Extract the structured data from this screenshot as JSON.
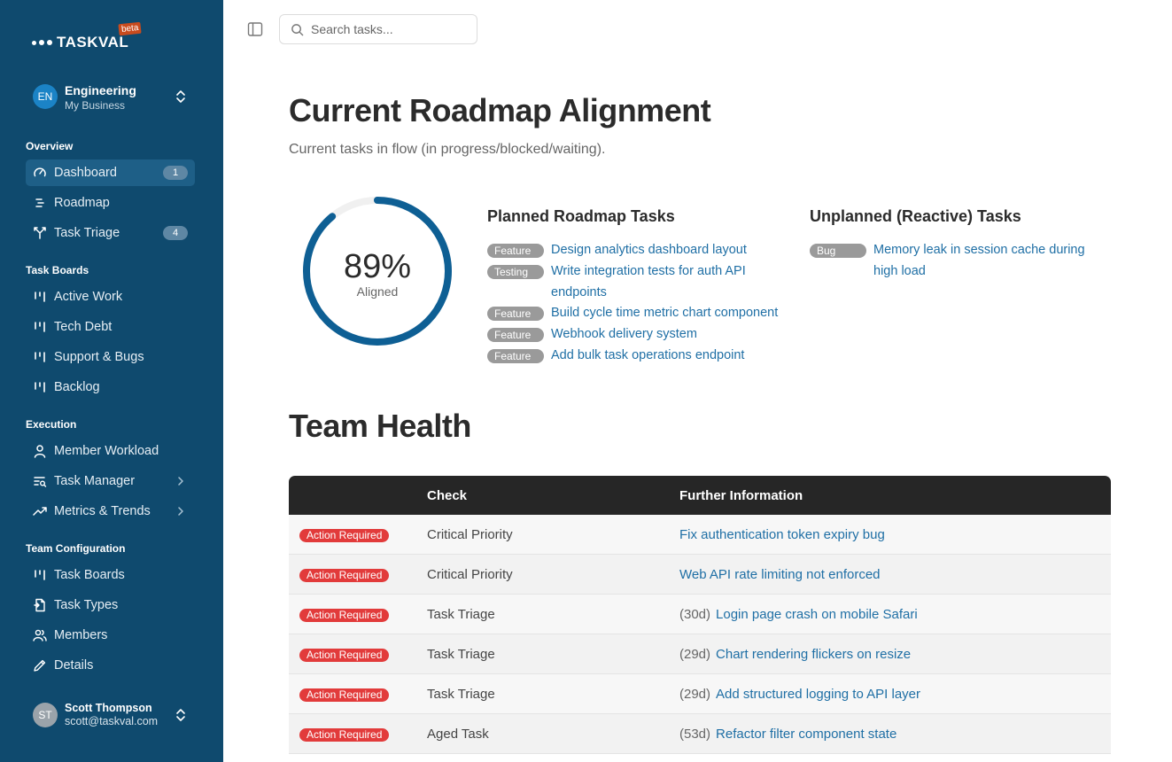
{
  "app": {
    "logo": "TASKVAL",
    "beta": "beta"
  },
  "org": {
    "initials": "EN",
    "name": "Engineering",
    "sub": "My Business"
  },
  "sidebar": {
    "sections": [
      {
        "title": "Overview"
      },
      {
        "title": "Task Boards"
      },
      {
        "title": "Execution"
      },
      {
        "title": "Team Configuration"
      }
    ],
    "items": [
      {
        "label": "Dashboard",
        "badge": "1",
        "icon": "gauge-icon"
      },
      {
        "label": "Roadmap",
        "icon": "list-icon"
      },
      {
        "label": "Task Triage",
        "badge": "4",
        "icon": "split-icon"
      },
      {
        "label": "Active Work",
        "icon": "board-icon"
      },
      {
        "label": "Tech Debt",
        "icon": "board-icon"
      },
      {
        "label": "Support & Bugs",
        "icon": "board-icon"
      },
      {
        "label": "Backlog",
        "icon": "board-icon"
      },
      {
        "label": "Member Workload",
        "icon": "user-icon"
      },
      {
        "label": "Task Manager",
        "icon": "list-search-icon"
      },
      {
        "label": "Metrics & Trends",
        "icon": "trend-icon"
      },
      {
        "label": "Task Boards",
        "icon": "board-icon"
      },
      {
        "label": "Task Types",
        "icon": "file-icon"
      },
      {
        "label": "Members",
        "icon": "users-icon"
      },
      {
        "label": "Details",
        "icon": "pencil-icon"
      }
    ]
  },
  "user": {
    "initials": "ST",
    "name": "Scott Thompson",
    "email": "scott@taskval.com"
  },
  "search": {
    "placeholder": "Search tasks..."
  },
  "main": {
    "title": "Current Roadmap Alignment",
    "subtitle": "Current tasks in flow (in progress/blocked/waiting).",
    "alignment": {
      "value": "89%",
      "percent": 89,
      "label": "Aligned",
      "color": "#0e5f94"
    },
    "planned": {
      "title": "Planned Roadmap Tasks",
      "tasks": [
        {
          "tag": "Feature",
          "text": "Design analytics dashboard layout"
        },
        {
          "tag": "Testing",
          "text": "Write integration tests for auth API endpoints"
        },
        {
          "tag": "Feature",
          "text": "Build cycle time metric chart component"
        },
        {
          "tag": "Feature",
          "text": "Webhook delivery system"
        },
        {
          "tag": "Feature",
          "text": "Add bulk task operations endpoint"
        }
      ]
    },
    "unplanned": {
      "title": "Unplanned (Reactive) Tasks",
      "tasks": [
        {
          "tag": "Bug",
          "text": "Memory leak in session cache during high load"
        }
      ]
    },
    "health": {
      "title": "Team Health",
      "columns": [
        "Check",
        "Further Information"
      ],
      "rows": [
        {
          "status": "Action Required",
          "check": "Critical Priority",
          "days": "",
          "info": "Fix authentication token expiry bug"
        },
        {
          "status": "Action Required",
          "check": "Critical Priority",
          "days": "",
          "info": "Web API rate limiting not enforced"
        },
        {
          "status": "Action Required",
          "check": "Task Triage",
          "days": "(30d)",
          "info": "Login page crash on mobile Safari"
        },
        {
          "status": "Action Required",
          "check": "Task Triage",
          "days": "(29d)",
          "info": "Chart rendering flickers on resize"
        },
        {
          "status": "Action Required",
          "check": "Task Triage",
          "days": "(29d)",
          "info": "Add structured logging to API layer"
        },
        {
          "status": "Action Required",
          "check": "Aged Task",
          "days": "(53d)",
          "info": "Refactor filter component state"
        }
      ]
    }
  }
}
